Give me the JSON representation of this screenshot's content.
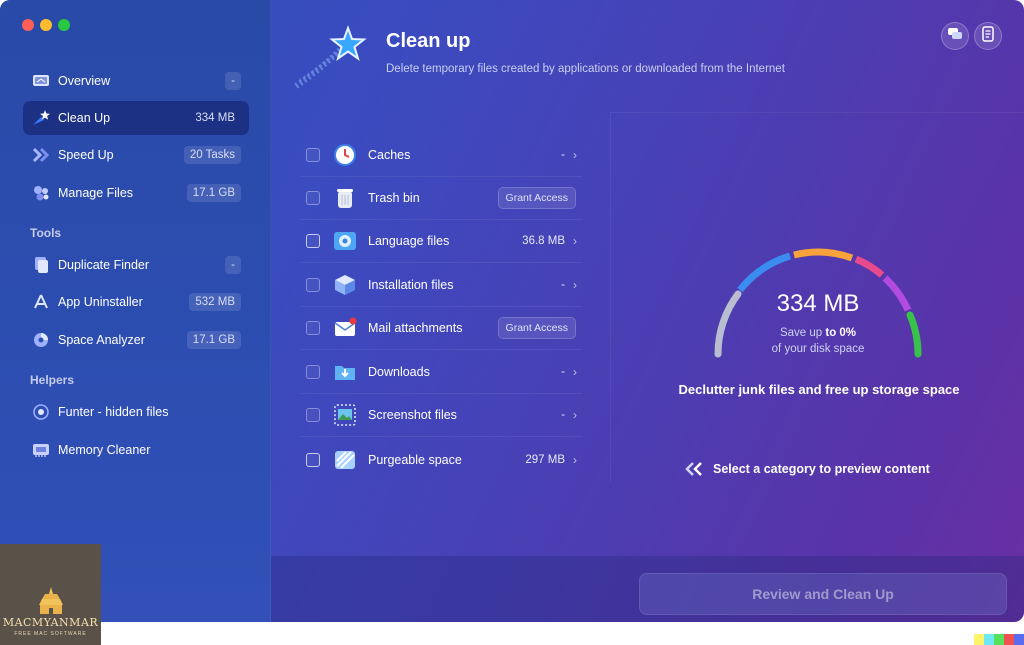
{
  "sidebar": {
    "items": [
      {
        "label": "Overview",
        "badge": "-",
        "icon": "laptop-icon"
      },
      {
        "label": "Clean Up",
        "badge": "334 MB",
        "icon": "broom-star-icon",
        "active": true
      },
      {
        "label": "Speed Up",
        "badge": "20 Tasks",
        "icon": "double-chevron-icon"
      },
      {
        "label": "Manage Files",
        "badge": "17.1 GB",
        "icon": "dots-cluster-icon"
      }
    ],
    "tools_title": "Tools",
    "tools": [
      {
        "label": "Duplicate Finder",
        "badge": "-",
        "icon": "duplicate-icon"
      },
      {
        "label": "App Uninstaller",
        "badge": "532 MB",
        "icon": "uninstaller-icon"
      },
      {
        "label": "Space Analyzer",
        "badge": "17.1 GB",
        "icon": "pie-icon"
      }
    ],
    "helpers_title": "Helpers",
    "helpers": [
      {
        "label": "Funter - hidden files",
        "icon": "eye-icon"
      },
      {
        "label": "Memory Cleaner",
        "icon": "memory-chip-icon"
      }
    ]
  },
  "header": {
    "title": "Clean up",
    "subtitle": "Delete temporary files created by applications or downloaded from the Internet"
  },
  "categories": [
    {
      "label": "Caches",
      "value": "-",
      "icon": "clock-icon",
      "action": "chevron"
    },
    {
      "label": "Trash bin",
      "value": "",
      "icon": "trash-icon",
      "action": "Grant Access"
    },
    {
      "label": "Language files",
      "value": "36.8 MB",
      "icon": "language-icon",
      "action": "chevron"
    },
    {
      "label": "Installation files",
      "value": "-",
      "icon": "package-icon",
      "action": "chevron"
    },
    {
      "label": "Mail attachments",
      "value": "",
      "icon": "mail-icon",
      "action": "Grant Access"
    },
    {
      "label": "Downloads",
      "value": "-",
      "icon": "download-folder-icon",
      "action": "chevron"
    },
    {
      "label": "Screenshot files",
      "value": "-",
      "icon": "screenshot-icon",
      "action": "chevron"
    },
    {
      "label": "Purgeable space",
      "value": "297 MB",
      "icon": "purgeable-icon",
      "action": "chevron"
    }
  ],
  "gauge": {
    "value": "334 MB",
    "save_prefix": "Save up",
    "save_amount": "to 0%",
    "save_suffix": "of your disk space",
    "colors": [
      "#b8bdd0",
      "#3b8cf0",
      "#f7a23a",
      "#e84a8e",
      "#b24be0",
      "#38c24a"
    ]
  },
  "declutter_text": "Declutter junk files and free up storage space",
  "select_text": "Select a category to preview content",
  "review_button": "Review and Clean Up",
  "watermark": {
    "title": "MACMYANMAR",
    "subtitle": "FREE MAC SOFTWARE"
  }
}
